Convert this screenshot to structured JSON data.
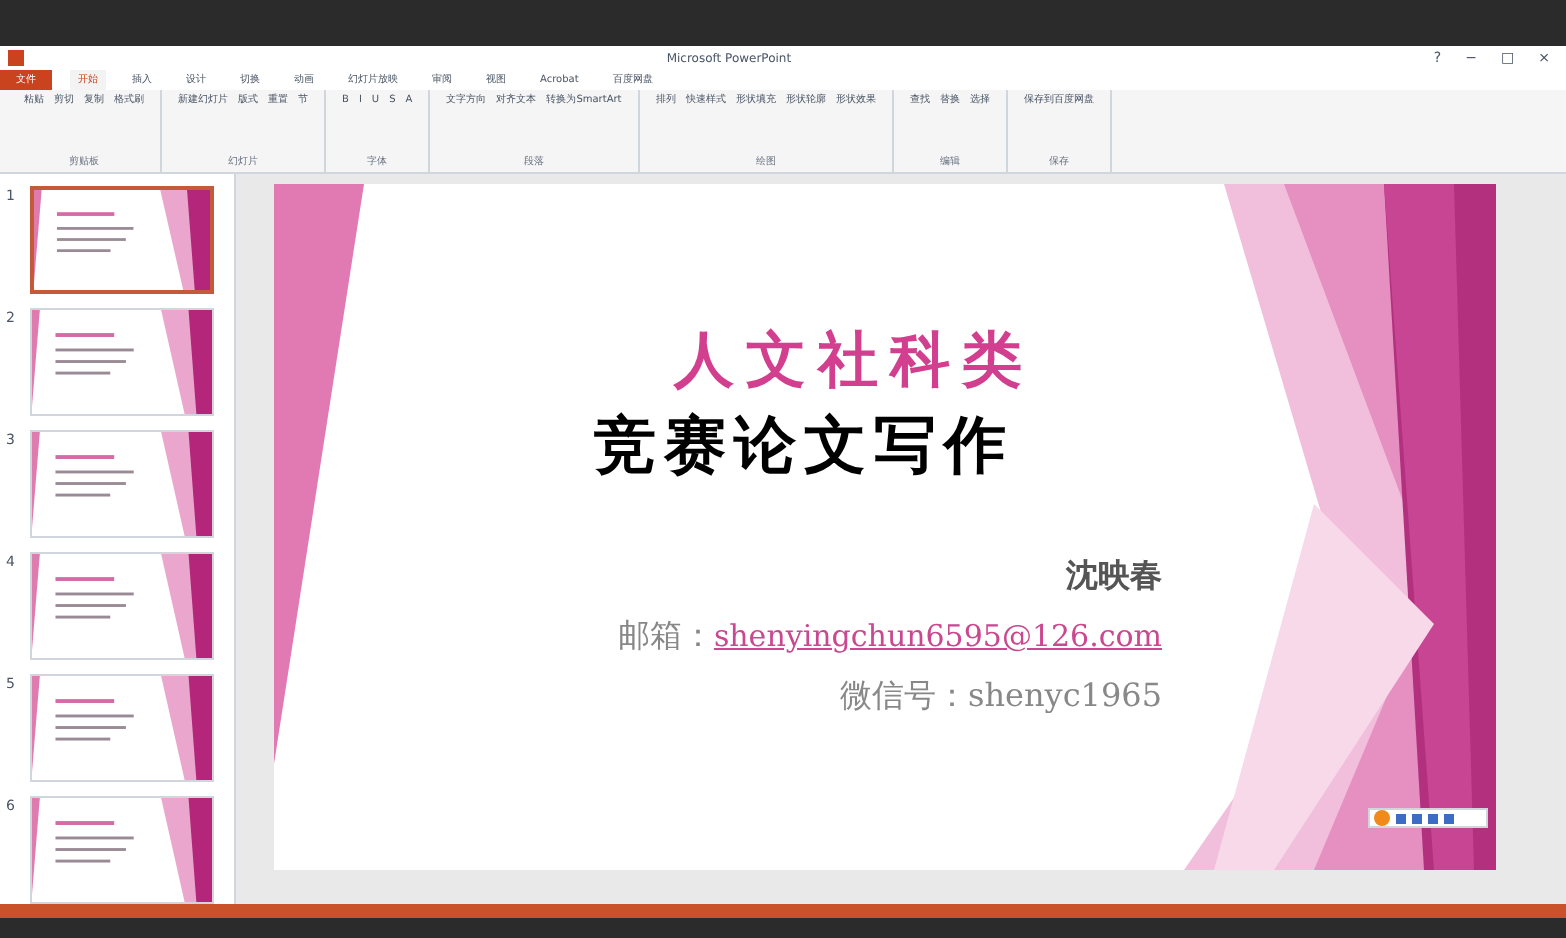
{
  "window": {
    "title": "Microsoft PowerPoint",
    "controls": [
      "?",
      "−",
      "□",
      "×"
    ]
  },
  "tabs": [
    {
      "label": "文件",
      "kind": "file",
      "selected": false
    },
    {
      "label": "开始",
      "kind": "tab",
      "selected": true
    },
    {
      "label": "插入",
      "kind": "tab",
      "selected": false
    },
    {
      "label": "设计",
      "kind": "tab",
      "selected": false
    },
    {
      "label": "切换",
      "kind": "tab",
      "selected": false
    },
    {
      "label": "动画",
      "kind": "tab",
      "selected": false
    },
    {
      "label": "幻灯片放映",
      "kind": "tab",
      "selected": false
    },
    {
      "label": "审阅",
      "kind": "tab",
      "selected": false
    },
    {
      "label": "视图",
      "kind": "tab",
      "selected": false
    },
    {
      "label": "Acrobat",
      "kind": "tab",
      "selected": false
    },
    {
      "label": "百度网盘",
      "kind": "tab",
      "selected": false
    }
  ],
  "ribbon_groups": [
    {
      "label": "剪贴板",
      "buttons": [
        "粘贴",
        "剪切",
        "复制",
        "格式刷"
      ]
    },
    {
      "label": "幻灯片",
      "buttons": [
        "新建幻灯片",
        "版式",
        "重置",
        "节"
      ]
    },
    {
      "label": "字体",
      "buttons": [
        "B",
        "I",
        "U",
        "S",
        "A"
      ]
    },
    {
      "label": "段落",
      "buttons": [
        "文字方向",
        "对齐文本",
        "转换为SmartArt"
      ]
    },
    {
      "label": "绘图",
      "buttons": [
        "排列",
        "快速样式",
        "形状填充",
        "形状轮廓",
        "形状效果"
      ]
    },
    {
      "label": "编辑",
      "buttons": [
        "查找",
        "替换",
        "选择"
      ]
    },
    {
      "label": "保存",
      "buttons": [
        "保存到百度网盘"
      ]
    }
  ],
  "thumbnails": [
    {
      "number": "1",
      "selected": true
    },
    {
      "number": "2",
      "selected": false
    },
    {
      "number": "3",
      "selected": false
    },
    {
      "number": "4",
      "selected": false
    },
    {
      "number": "5",
      "selected": false
    },
    {
      "number": "6",
      "selected": false
    }
  ],
  "slide": {
    "title": "人文社科类",
    "subtitle": "竞赛论文写作",
    "author": "沈映春",
    "email_label": "邮箱：",
    "email": "shenyingchun6595@126.com",
    "wechat": "微信号：shenyc1965"
  }
}
